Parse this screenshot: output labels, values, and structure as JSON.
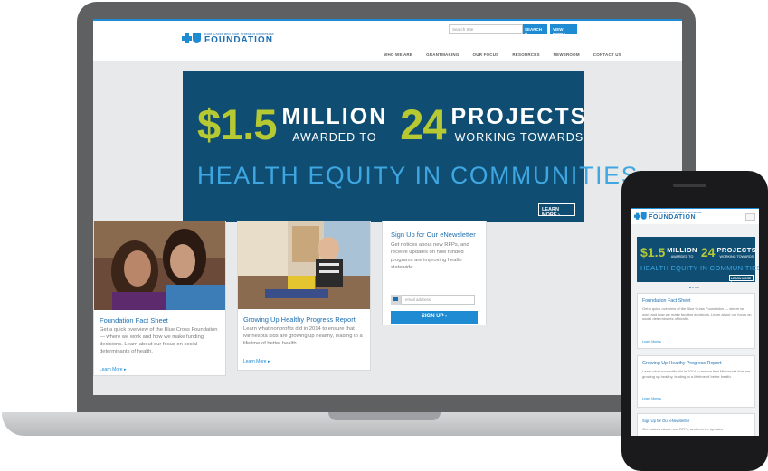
{
  "desktop": {
    "logo": {
      "small": "Blue Cross and Blue Shield of Minnesota",
      "big": "FOUNDATION"
    },
    "search": {
      "placeholder": "Search Site",
      "button": "SEARCH"
    },
    "rfp_button": "VIEW RFPs",
    "nav": [
      "WHO WE ARE",
      "GRANTMAKING",
      "OUR FOCUS",
      "RESOURCES",
      "NEWSROOM",
      "CONTACT US"
    ],
    "hero": {
      "amount": "$1.5",
      "amount_word": "MILLION",
      "amount_sub": "AWARDED TO",
      "count": "24",
      "count_word": "PROJECTS",
      "count_sub": "WORKING TOWARDS",
      "headline": "HEALTH EQUITY IN COMMUNITIES",
      "button": "LEARN MORE"
    },
    "carousel": {
      "total": 4,
      "active": 1
    },
    "cards": [
      {
        "title": "Foundation Fact Sheet",
        "body": "Get a quick overview of the Blue Cross Foundation — where we work and how we make funding decisions. Learn about our focus on social determinants of health.",
        "link": "Learn More"
      },
      {
        "title": "Growing Up Healthy Progress Report",
        "body": "Learn what nonprofits did in 2014 to ensure that Minnesota kids are growing up healthy, leading to a lifetime of better health.",
        "link": "Learn More"
      }
    ],
    "newsletter": {
      "title": "Sign Up for Our eNewsletter",
      "body": "Get notices about new RFPs, and receive updates on how funded programs are improving health statewide.",
      "email_placeholder": "email address",
      "button": "SIGN UP"
    }
  },
  "mobile": {
    "logo": {
      "small": "Blue Cross and Blue Shield of Minnesota",
      "big": "FOUNDATION"
    },
    "hero": {
      "amount": "$1.5",
      "amount_word": "MILLION",
      "amount_sub": "AWARDED TO",
      "count": "24",
      "count_word": "PROJECTS",
      "count_sub": "WORKING TOWARDS",
      "headline": "HEALTH EQUITY IN COMMUNITIES",
      "button": "LEARN MORE"
    },
    "cards": [
      {
        "title": "Foundation Fact Sheet",
        "body": "Get a quick overview of the Blue Cross Foundation — where we work and how we make funding decisions. Learn about our focus on social determinants of health.",
        "link": "Learn More"
      },
      {
        "title": "Growing Up Healthy Progress Report",
        "body": "Learn what nonprofits did in 2014 to ensure that Minnesota kids are growing up healthy, leading to a lifetime of better health.",
        "link": "Learn More"
      },
      {
        "title": "Sign Up for Our eNewsletter",
        "body": "Get notices about new RFPs, and receive updates"
      }
    ]
  },
  "colors": {
    "brand_blue": "#1f8bd2",
    "hero_navy": "#0f4e72",
    "accent_green": "#b6c932",
    "headline_blue": "#3ea7e2"
  }
}
